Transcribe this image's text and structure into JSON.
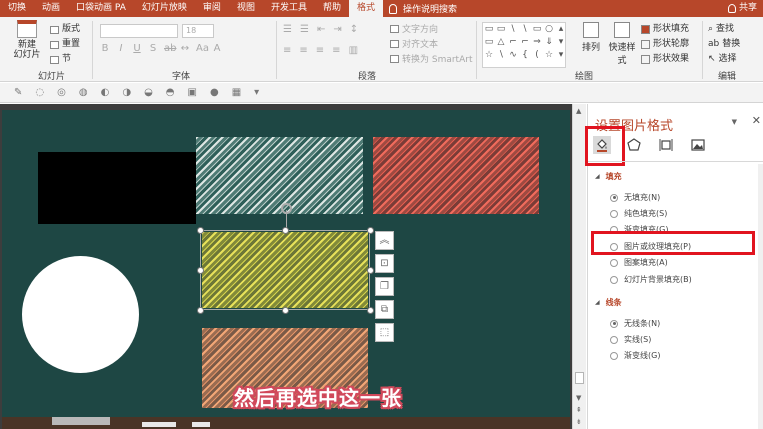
{
  "tabs": {
    "items": [
      "切换",
      "动画",
      "口袋动画 PA",
      "幻灯片放映",
      "审阅",
      "视图",
      "开发工具",
      "帮助",
      "格式"
    ],
    "search": "操作说明搜索",
    "share": "共享"
  },
  "ribbon": {
    "new_slide": "新建\n幻灯片",
    "layout": "版式",
    "reset": "重置",
    "section": "节",
    "font_size": "18",
    "text_direction": "文字方向",
    "align_text": "对齐文本",
    "convert_smartart": "转换为 SmartArt",
    "arrange": "排列",
    "quick_styles": "快速样式",
    "shape_fill": "形状填充",
    "shape_outline": "形状轮廓",
    "shape_effects": "形状效果",
    "find": "查找",
    "replace": "替换",
    "select": "选择",
    "groups": {
      "slides": "幻灯片",
      "font": "字体",
      "paragraph": "段落",
      "drawing": "绘图",
      "editing": "编辑"
    }
  },
  "slide": {
    "subtitle": "然后再选中这一张"
  },
  "pane": {
    "title": "设置图片格式",
    "fill_section": "填充",
    "fill_options": [
      {
        "label": "无填充(N)",
        "selected": true
      },
      {
        "label": "纯色填充(S)",
        "selected": false
      },
      {
        "label": "渐变填充(G)",
        "selected": false
      },
      {
        "label": "图片或纹理填充(P)",
        "selected": false
      },
      {
        "label": "图案填充(A)",
        "selected": false
      },
      {
        "label": "幻灯片背景填充(B)",
        "selected": false
      }
    ],
    "line_section": "线条",
    "line_options": [
      {
        "label": "无线条(N)",
        "selected": true
      },
      {
        "label": "实线(S)",
        "selected": false
      },
      {
        "label": "渐变线(G)",
        "selected": false
      }
    ]
  },
  "colors": {
    "accent": "#b7472a",
    "slide_bg": "#1e4744",
    "highlight": "#e1141f",
    "subtitle_outline": "#d1495b"
  }
}
